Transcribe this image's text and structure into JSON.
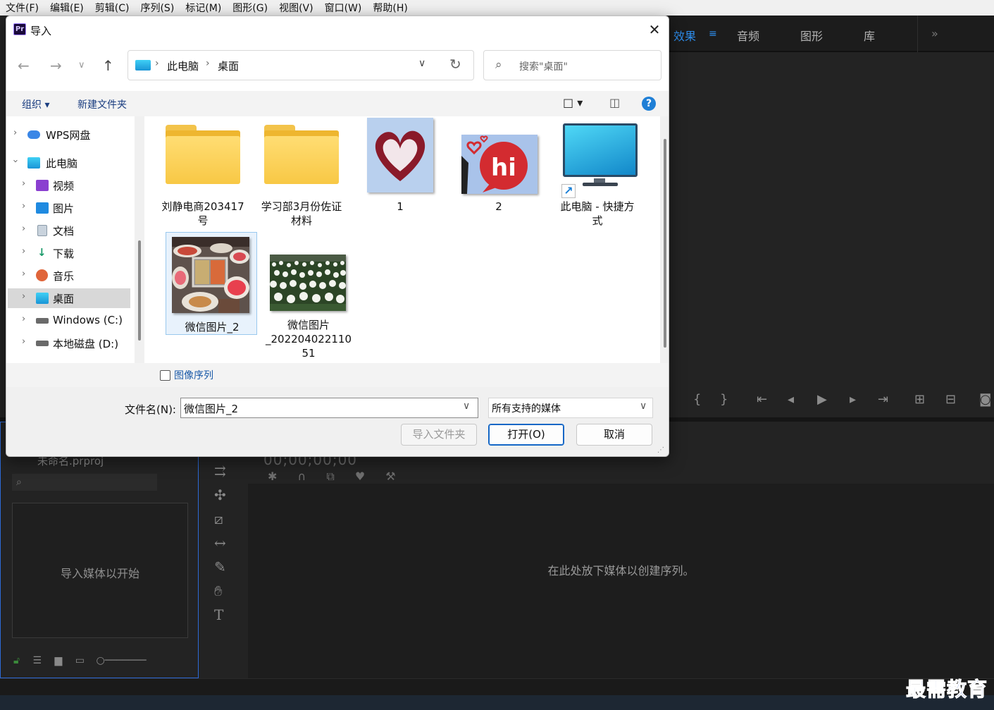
{
  "menubar": {
    "items": [
      "文件(F)",
      "编辑(E)",
      "剪辑(C)",
      "序列(S)",
      "标记(M)",
      "图形(G)",
      "视图(V)",
      "窗口(W)",
      "帮助(H)"
    ]
  },
  "workspace_tabs": {
    "items": [
      "效果",
      "音频",
      "图形",
      "库"
    ],
    "active": "效果",
    "more_icon": "double-chevron-right-icon"
  },
  "project_panel": {
    "name": "未命名.prproj",
    "drop_hint": "导入媒体以开始"
  },
  "timeline": {
    "timecode": "00;00;00;00",
    "drop_hint": "在此处放下媒体以创建序列。"
  },
  "watermark": "最需教育",
  "dialog": {
    "app_icon_text": "Pr",
    "title": "导入",
    "breadcrumb": [
      "此电脑",
      "桌面"
    ],
    "search_placeholder": "搜索\"桌面\"",
    "toolbar": {
      "organize": "组织 ▾",
      "new_folder": "新建文件夹"
    },
    "nav_items": [
      {
        "label": "WPS网盘",
        "icon": "cloud-icon",
        "level": 0
      },
      {
        "label": "此电脑",
        "icon": "computer-icon",
        "level": 0,
        "expanded": true
      },
      {
        "label": "视频",
        "icon": "video-icon",
        "level": 1
      },
      {
        "label": "图片",
        "icon": "picture-icon",
        "level": 1
      },
      {
        "label": "文档",
        "icon": "document-icon",
        "level": 1
      },
      {
        "label": "下载",
        "icon": "download-icon",
        "level": 1
      },
      {
        "label": "音乐",
        "icon": "music-icon",
        "level": 1
      },
      {
        "label": "桌面",
        "icon": "desktop-icon",
        "level": 1,
        "selected": true
      },
      {
        "label": "Windows (C:)",
        "icon": "drive-icon",
        "level": 1
      },
      {
        "label": "本地磁盘 (D:)",
        "icon": "drive-icon",
        "level": 1
      }
    ],
    "files": [
      {
        "name_lines": [
          "刘静电商203417",
          "号"
        ],
        "type": "folder"
      },
      {
        "name_lines": [
          "学习部3月份佐证",
          "材料"
        ],
        "type": "folder"
      },
      {
        "name_lines": [
          "1"
        ],
        "type": "image-heart"
      },
      {
        "name_lines": [
          "2"
        ],
        "type": "image-hi"
      },
      {
        "name_lines": [
          "此电脑 - 快捷方",
          "式"
        ],
        "type": "shortcut"
      },
      {
        "name_lines": [
          "微信图片_2"
        ],
        "type": "image-food",
        "selected": true
      },
      {
        "name_lines": [
          "微信图片",
          "_202204022110",
          "51"
        ],
        "type": "image-flowers"
      }
    ],
    "image_sequence_label": "图像序列",
    "image_sequence_checked": false,
    "filename_label": "文件名(N):",
    "filename_value": "微信图片_2",
    "filetype_value": "所有支持的媒体",
    "buttons": {
      "import_folder": "导入文件夹",
      "open": "打开(O)",
      "cancel": "取消"
    }
  }
}
